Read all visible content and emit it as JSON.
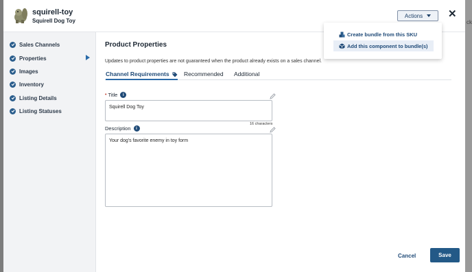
{
  "header": {
    "sku": "squirell-toy",
    "product_name": "Squirell Dog Toy",
    "actions_label": "Actions",
    "close_glyph": "✕"
  },
  "actions_menu": {
    "items": [
      {
        "label": "Create bundle from this SKU",
        "icon": "bundle-icon"
      },
      {
        "label": "Add this component to bundle(s)",
        "icon": "box-icon"
      }
    ]
  },
  "sidebar": {
    "items": [
      {
        "label": "Sales Channels"
      },
      {
        "label": "Properties",
        "active": true
      },
      {
        "label": "Images"
      },
      {
        "label": "Inventory"
      },
      {
        "label": "Listing Details"
      },
      {
        "label": "Listing Statuses"
      }
    ]
  },
  "main": {
    "title": "Product Properties",
    "notice": "Updates to product properties are not guaranteed when the product already exists on a sales channel.",
    "tabs": [
      {
        "label": "Channel Requirements"
      },
      {
        "label": "Recommended"
      },
      {
        "label": "Additional"
      }
    ],
    "title_field": {
      "required_mark": "•",
      "label": "Title",
      "value": "Squirell Dog Toy",
      "counter": "16 characters"
    },
    "description_field": {
      "label": "Description",
      "value": "Your dog's favorite enemy in toy form"
    }
  },
  "footer": {
    "cancel_label": "Cancel",
    "save_label": "Save"
  },
  "colors": {
    "accent": "#235987",
    "sidebar_bg": "#f2f3f5",
    "check": "#2a5d8c"
  }
}
